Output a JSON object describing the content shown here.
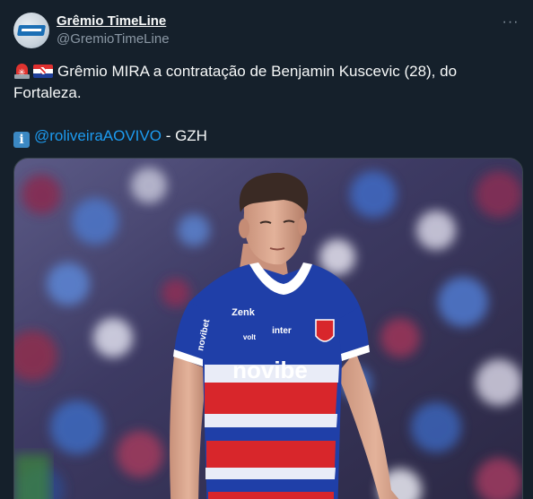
{
  "author": {
    "display_name": "Grêmio TimeLine",
    "handle": "@GremioTimeLine",
    "avatar_icon": "gremio-timeline-logo"
  },
  "more_icon": "more-options-icon",
  "tweet": {
    "line1_text": "Grêmio MIRA a contratação de Benjamin Kuscevic (28), do",
    "line2_text": "Fortaleza.",
    "source_mention": "@roliveiraAOVIVO",
    "source_suffix": " - GZH",
    "emojis": [
      "siren-icon",
      "croatia-flag-icon",
      "info-icon"
    ]
  },
  "media": {
    "jersey_sponsor": "novibe",
    "jersey_brand": "Zenk",
    "jersey_sleeve_sponsor": "novibet",
    "jersey_chest_small": "inter",
    "jersey_chest_small2": "volt",
    "colors": {
      "jersey_blue": "#1f3fa8",
      "jersey_red": "#d8262b",
      "crowd": "#3b3556"
    }
  }
}
